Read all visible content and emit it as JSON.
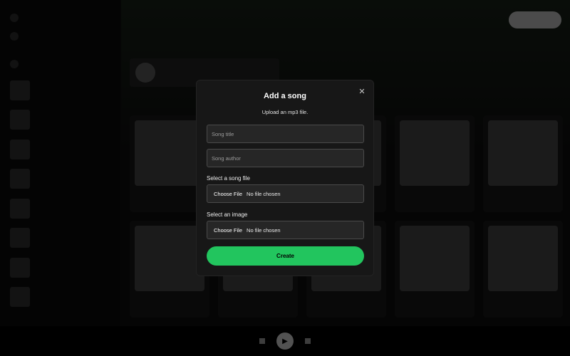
{
  "colors": {
    "accent": "#22c55e",
    "modal_bg": "#171717",
    "field_bg": "#262626",
    "field_border": "#4a4a4a",
    "page_bg": "#121212",
    "overlay": "rgba(0,0,0,0.68)"
  },
  "modal": {
    "title": "Add a song",
    "subtitle": "Upload an mp3 file.",
    "close_icon": "close-icon",
    "song_title_placeholder": "Song title",
    "song_author_placeholder": "Song author",
    "song_file_label": "Select a song file",
    "image_label": "Select an image",
    "choose_file_label": "Choose File",
    "no_file_text": "No file chosen",
    "create_label": "Create"
  }
}
